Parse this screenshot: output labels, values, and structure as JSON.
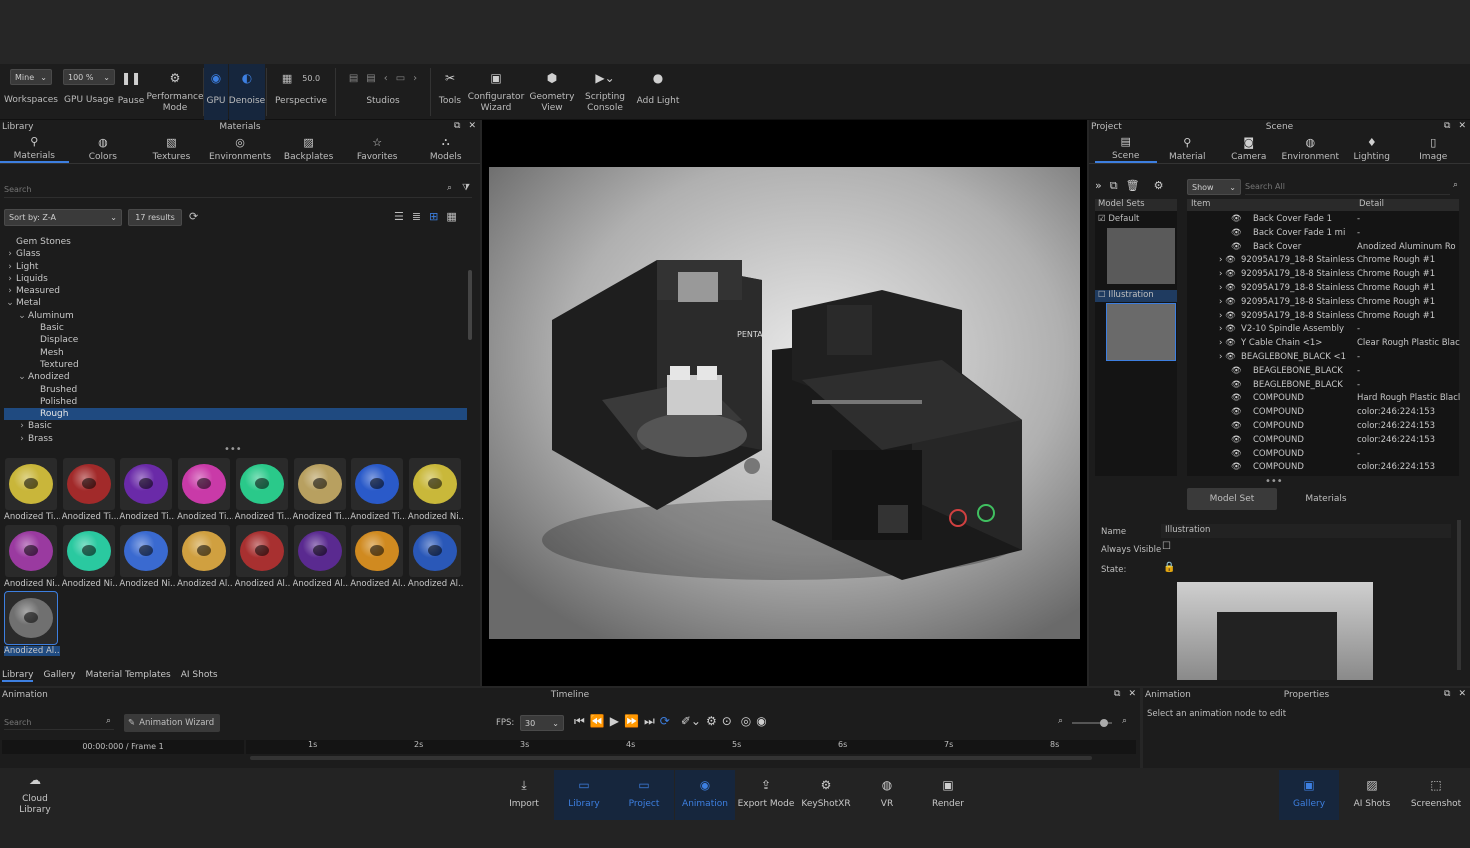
{
  "toolbar": {
    "workspace_select": "Mine",
    "workspace_label": "Workspaces",
    "gpu_select": "100 %",
    "gpu_label": "GPU Usage",
    "pause_label": "Pause",
    "perf_label1": "Performance",
    "perf_label2": "Mode",
    "gpu_toggle": "GPU",
    "denoise": "Denoise",
    "perspective_value": "50.0",
    "perspective_label": "Perspective",
    "studios": "Studios",
    "tools": "Tools",
    "config1": "Configurator",
    "config2": "Wizard",
    "geom1": "Geometry",
    "geom2": "View",
    "script1": "Scripting",
    "script2": "Console",
    "addlight": "Add Light"
  },
  "library": {
    "title": "Library",
    "center": "Materials",
    "tabs": [
      "Materials",
      "Colors",
      "Textures",
      "Environments",
      "Backplates",
      "Favorites",
      "Models"
    ],
    "search_placeholder": "Search",
    "sort": "Sort by: Z-A",
    "results": "17 results",
    "tree": [
      {
        "t": "Gem Stones",
        "d": 0,
        "e": ""
      },
      {
        "t": "Glass",
        "d": 0,
        "e": "›"
      },
      {
        "t": "Light",
        "d": 0,
        "e": "›"
      },
      {
        "t": "Liquids",
        "d": 0,
        "e": "›"
      },
      {
        "t": "Measured",
        "d": 0,
        "e": "›"
      },
      {
        "t": "Metal",
        "d": 0,
        "e": "⌄"
      },
      {
        "t": "Aluminum",
        "d": 1,
        "e": "⌄"
      },
      {
        "t": "Basic",
        "d": 2,
        "e": ""
      },
      {
        "t": "Displace",
        "d": 2,
        "e": ""
      },
      {
        "t": "Mesh",
        "d": 2,
        "e": ""
      },
      {
        "t": "Textured",
        "d": 2,
        "e": ""
      },
      {
        "t": "Anodized",
        "d": 1,
        "e": "⌄"
      },
      {
        "t": "Brushed",
        "d": 2,
        "e": ""
      },
      {
        "t": "Polished",
        "d": 2,
        "e": ""
      },
      {
        "t": "Rough",
        "d": 2,
        "e": "",
        "hl": true
      },
      {
        "t": "Basic",
        "d": 1,
        "e": "›"
      },
      {
        "t": "Brass",
        "d": 1,
        "e": "›"
      }
    ],
    "swatches": [
      {
        "l": "Anodized Ti...",
        "c": "#c9b63a"
      },
      {
        "l": "Anodized Ti...",
        "c": "#a22a2a"
      },
      {
        "l": "Anodized Ti...",
        "c": "#6a2aa8"
      },
      {
        "l": "Anodized Ti...",
        "c": "#c93aa8"
      },
      {
        "l": "Anodized Ti...",
        "c": "#2ac98a"
      },
      {
        "l": "Anodized Ti...",
        "c": "#b8a060"
      },
      {
        "l": "Anodized Ti...",
        "c": "#2a5ac9"
      },
      {
        "l": "Anodized Ni...",
        "c": "#c9b83a"
      },
      {
        "l": "Anodized Ni...",
        "c": "#9a3aa0"
      },
      {
        "l": "Anodized Ni...",
        "c": "#2ac9a0"
      },
      {
        "l": "Anodized Ni...",
        "c": "#3a6ad0"
      },
      {
        "l": "Anodized Al...",
        "c": "#d0a040"
      },
      {
        "l": "Anodized Al...",
        "c": "#a83030"
      },
      {
        "l": "Anodized Al...",
        "c": "#5a2a90"
      },
      {
        "l": "Anodized Al...",
        "c": "#d08a20"
      },
      {
        "l": "Anodized Al...",
        "c": "#2a58b8"
      },
      {
        "l": "Anodized Al...",
        "c": "#707070"
      }
    ],
    "bottom_tabs": [
      "Library",
      "Gallery",
      "Material Templates",
      "AI Shots"
    ]
  },
  "viewport": {
    "brand": "PENTA"
  },
  "project": {
    "title": "Project",
    "center": "Scene",
    "tabs": [
      "Scene",
      "Material",
      "Camera",
      "Environment",
      "Lighting",
      "Image"
    ],
    "show": "Show",
    "search_placeholder": "Search All",
    "modelsets_header": "Model Sets",
    "set1": "Default",
    "set2": "Illustration",
    "col_item": "Item",
    "col_detail": "Detail",
    "rows": [
      {
        "i": "Back Cover Fade 1",
        "d": "-",
        "x": 66
      },
      {
        "i": "Back Cover Fade 1 mi",
        "d": "-",
        "x": 66
      },
      {
        "i": "Back Cover",
        "d": "Anodized Aluminum Ro",
        "x": 66
      },
      {
        "i": "92095A179_18-8 Stainless",
        "d": "Chrome Rough #1",
        "x": 54
      },
      {
        "i": "92095A179_18-8 Stainless",
        "d": "Chrome Rough #1",
        "x": 54
      },
      {
        "i": "92095A179_18-8 Stainless",
        "d": "Chrome Rough #1",
        "x": 54
      },
      {
        "i": "92095A179_18-8 Stainless",
        "d": "Chrome Rough #1",
        "x": 54
      },
      {
        "i": "92095A179_18-8 Stainless",
        "d": "Chrome Rough #1",
        "x": 54
      },
      {
        "i": "V2-10 Spindle Assembly",
        "d": "-",
        "x": 54
      },
      {
        "i": "Y Cable Chain <1>",
        "d": "Clear Rough Plastic Blac",
        "x": 54
      },
      {
        "i": "BEAGLEBONE_BLACK <1",
        "d": "-",
        "x": 54
      },
      {
        "i": "BEAGLEBONE_BLACK",
        "d": "-",
        "x": 66
      },
      {
        "i": "BEAGLEBONE_BLACK",
        "d": "-",
        "x": 66
      },
      {
        "i": "COMPOUND",
        "d": "Hard Rough Plastic Blacl",
        "x": 66
      },
      {
        "i": "COMPOUND",
        "d": "color:246:224:153",
        "x": 66
      },
      {
        "i": "COMPOUND",
        "d": "color:246:224:153",
        "x": 66
      },
      {
        "i": "COMPOUND",
        "d": "color:246:224:153",
        "x": 66
      },
      {
        "i": "COMPOUND",
        "d": "-",
        "x": 66
      },
      {
        "i": "COMPOUND",
        "d": "color:246:224:153",
        "x": 66
      }
    ],
    "btn_modelset": "Model Set",
    "btn_materials": "Materials",
    "name_label": "Name",
    "name_value": "Illustration",
    "always_visible": "Always Visible",
    "state": "State:"
  },
  "animation": {
    "title": "Animation",
    "center": "Timeline",
    "search_placeholder": "Search",
    "wizard": "Animation Wizard",
    "fps_label": "FPS:",
    "fps_value": "30",
    "time": "00:00:000 / Frame 1",
    "ticks": [
      "1s",
      "2s",
      "3s",
      "4s",
      "5s",
      "6s",
      "7s",
      "8s"
    ]
  },
  "properties": {
    "title": "Animation",
    "center": "Properties",
    "hint": "Select an animation node to edit"
  },
  "dock": {
    "cloud1": "Cloud",
    "cloud2": "Library",
    "items": [
      "Import",
      "Library",
      "Project",
      "Animation",
      "Export Mode",
      "KeyShotXR",
      "VR",
      "Render"
    ],
    "right": [
      "Gallery",
      "AI Shots",
      "Screenshot"
    ]
  }
}
